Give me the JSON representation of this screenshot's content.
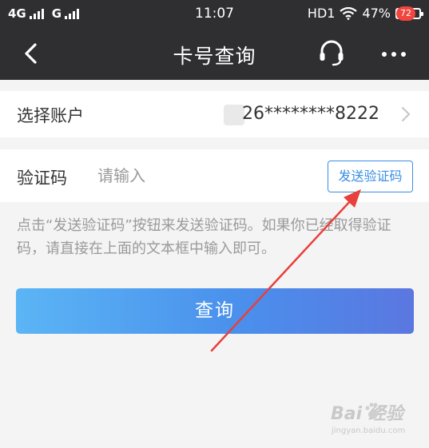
{
  "status_bar": {
    "network": [
      "4G",
      "G"
    ],
    "time": "11:07",
    "hd": "HD1",
    "battery": "47%",
    "battery_level": 0.47
  },
  "header": {
    "title": "卡号查询",
    "badge": "72",
    "icons": [
      "back-icon",
      "headset-icon",
      "more-icon"
    ]
  },
  "account_row": {
    "label": "选择账户",
    "value": "26********8222"
  },
  "verify_row": {
    "label": "验证码",
    "placeholder": "请输入",
    "value": "",
    "send_button": "发送验证码"
  },
  "hint": "点击“发送验证码”按钮来发送验证码。如果你已经取得验证码，请直接在上面的文本框中输入即可。",
  "query_button": "查询",
  "watermark": {
    "brand": "Bai 经验",
    "url": "jingyan.baidu.com"
  },
  "colors": {
    "topbar": "#2f2f31",
    "accent": "#3a8ee6",
    "badge": "#f2453d",
    "annotation_arrow": "#e8403a"
  }
}
